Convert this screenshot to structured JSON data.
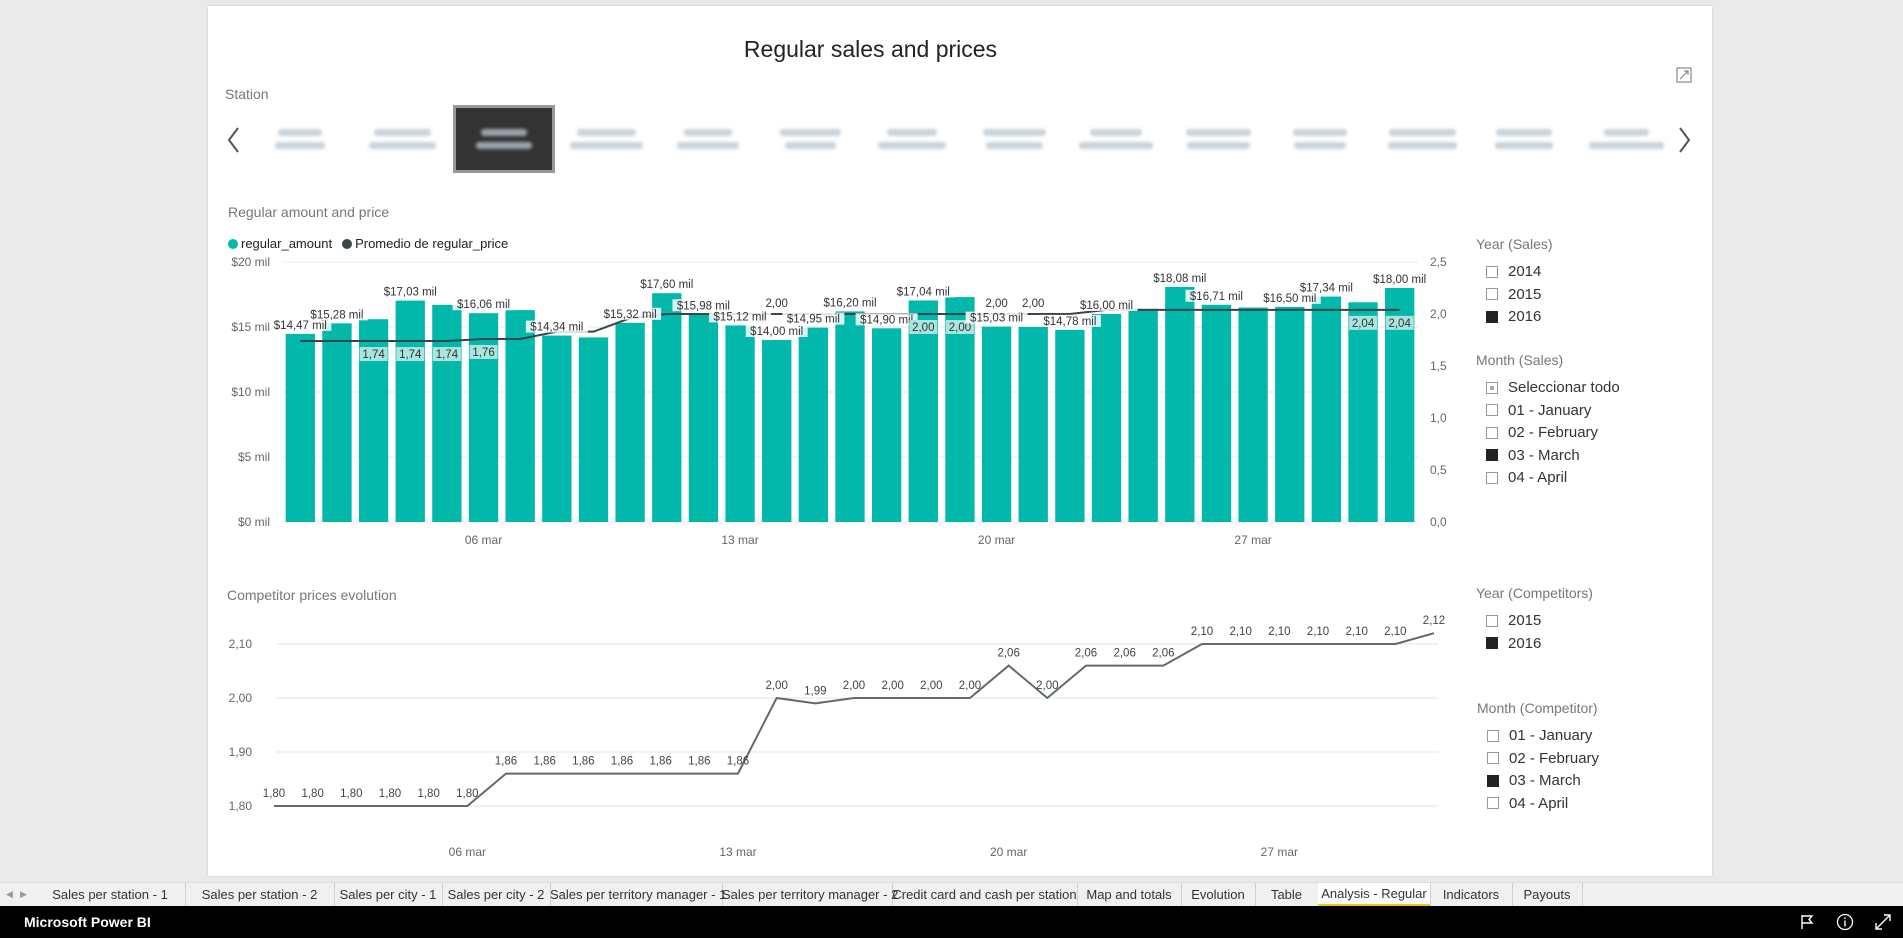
{
  "report": {
    "title": "Regular sales and prices",
    "station_label": "Station",
    "stations_count": 14,
    "selected_station_index": 2
  },
  "bar_chart": {
    "title": "Regular amount and price",
    "legend": [
      {
        "name": "regular_amount",
        "color": "#01b8aa"
      },
      {
        "name": "Promedio de regular_price",
        "color": "#374649"
      }
    ]
  },
  "line_chart": {
    "title": "Competitor prices evolution"
  },
  "filters": {
    "year_sales": {
      "title": "Year (Sales)",
      "items": [
        {
          "label": "2014",
          "state": "off"
        },
        {
          "label": "2015",
          "state": "off"
        },
        {
          "label": "2016",
          "state": "on"
        }
      ]
    },
    "month_sales": {
      "title": "Month (Sales)",
      "items": [
        {
          "label": "Seleccionar todo",
          "state": "partial"
        },
        {
          "label": "01 - January",
          "state": "off"
        },
        {
          "label": "02 - February",
          "state": "off"
        },
        {
          "label": "03 - March",
          "state": "on"
        },
        {
          "label": "04 - April",
          "state": "off"
        }
      ]
    },
    "year_comp": {
      "title": "Year (Competitors)",
      "items": [
        {
          "label": "2015",
          "state": "off"
        },
        {
          "label": "2016",
          "state": "on"
        }
      ]
    },
    "month_comp": {
      "title": "Month (Competitor)",
      "items": [
        {
          "label": "01 - January",
          "state": "off"
        },
        {
          "label": "02 - February",
          "state": "off"
        },
        {
          "label": "03 - March",
          "state": "on"
        },
        {
          "label": "04 - April",
          "state": "off"
        }
      ]
    }
  },
  "tabs": [
    "Sales per station - 1",
    "Sales per station - 2",
    "Sales per city - 1",
    "Sales per city - 2",
    "Sales per territory manager - 1",
    "Sales per territory manager - 2",
    "Credit card and cash per station",
    "Map and totals",
    "Evolution",
    "Table",
    "Analysis - Regular",
    "Indicators",
    "Payouts"
  ],
  "active_tab": "Analysis - Regular",
  "footer": {
    "brand": "Microsoft Power BI"
  },
  "chart_data": [
    {
      "type": "bar",
      "title": "Regular amount and price",
      "xlabel": "",
      "ylabel": "",
      "series": [
        {
          "name": "regular_amount",
          "axis": "left",
          "values": [
            14.47,
            15.28,
            15.6,
            17.03,
            16.7,
            16.06,
            16.3,
            14.34,
            14.2,
            15.32,
            17.6,
            15.98,
            15.12,
            14.0,
            14.95,
            16.2,
            14.9,
            17.04,
            17.3,
            15.03,
            15.0,
            14.78,
            16.0,
            16.4,
            18.08,
            16.71,
            16.5,
            16.55,
            17.34,
            16.9,
            18.0
          ]
        },
        {
          "name": "Promedio de regular_price",
          "axis": "right",
          "values": [
            1.74,
            1.74,
            1.74,
            1.74,
            1.74,
            1.76,
            1.76,
            1.83,
            1.83,
            1.96,
            2.0,
            2.0,
            2.0,
            2.0,
            2.0,
            2.0,
            2.0,
            2.0,
            2.0,
            2.0,
            2.0,
            2.0,
            2.04,
            2.04,
            2.04,
            2.04,
            2.04,
            2.04,
            2.04,
            2.04,
            2.04
          ]
        }
      ],
      "data_labels": [
        {
          "i": 0,
          "text": "$14,47 mil",
          "ty": "bar"
        },
        {
          "i": 1,
          "text": "$15,28 mil",
          "ty": "bar"
        },
        {
          "i": 2,
          "text": "1,74",
          "ty": "box"
        },
        {
          "i": 3,
          "text": "$17,03 mil",
          "ty": "bar"
        },
        {
          "i": 3,
          "text": "1,74",
          "ty": "box"
        },
        {
          "i": 4,
          "text": "1,74",
          "ty": "box"
        },
        {
          "i": 5,
          "text": "$16,06 mil",
          "ty": "bar"
        },
        {
          "i": 5,
          "text": "1,76",
          "ty": "box"
        },
        {
          "i": 7,
          "text": "$14,34 mil",
          "ty": "bar"
        },
        {
          "i": 9,
          "text": "$15,32 mil",
          "ty": "bar"
        },
        {
          "i": 10,
          "text": "$17,60 mil",
          "ty": "bar"
        },
        {
          "i": 11,
          "text": "$15,98 mil",
          "ty": "bar"
        },
        {
          "i": 12,
          "text": "$15,12 mil",
          "ty": "bar"
        },
        {
          "i": 13,
          "text": "2,00",
          "ty": "plain"
        },
        {
          "i": 13,
          "text": "$14,00 mil",
          "ty": "bar"
        },
        {
          "i": 14,
          "text": "$14,95 mil",
          "ty": "bar"
        },
        {
          "i": 15,
          "text": "$16,20 mil",
          "ty": "bar"
        },
        {
          "i": 16,
          "text": "$14,90 mil",
          "ty": "bar"
        },
        {
          "i": 17,
          "text": "$17,04 mil",
          "ty": "bar"
        },
        {
          "i": 17,
          "text": "2,00",
          "ty": "box"
        },
        {
          "i": 18,
          "text": "2,00",
          "ty": "box"
        },
        {
          "i": 19,
          "text": "2,00",
          "ty": "plain"
        },
        {
          "i": 19,
          "text": "$15,03 mil",
          "ty": "bar"
        },
        {
          "i": 20,
          "text": "2,00",
          "ty": "plain"
        },
        {
          "i": 21,
          "text": "$14,78 mil",
          "ty": "bar"
        },
        {
          "i": 22,
          "text": "$16,00 mil",
          "ty": "bar"
        },
        {
          "i": 24,
          "text": "$18,08 mil",
          "ty": "bar"
        },
        {
          "i": 25,
          "text": "$16,71 mil",
          "ty": "bar"
        },
        {
          "i": 27,
          "text": "$16,50 mil",
          "ty": "bar"
        },
        {
          "i": 28,
          "text": "$17,34 mil",
          "ty": "bar"
        },
        {
          "i": 29,
          "text": "2,04",
          "ty": "box"
        },
        {
          "i": 30,
          "text": "$18,00 mil",
          "ty": "bar"
        },
        {
          "i": 30,
          "text": "2,04",
          "ty": "box"
        }
      ],
      "left_ticks": [
        "$0 mil",
        "$5 mil",
        "$10 mil",
        "$15 mil",
        "$20 mil"
      ],
      "left_ylim": [
        0,
        20
      ],
      "right_ticks": [
        "0,0",
        "0,5",
        "1,0",
        "1,5",
        "2,0",
        "2,5"
      ],
      "right_ylim": [
        0,
        2.5
      ],
      "x_ticks": [
        {
          "i": 5,
          "text": "06 mar"
        },
        {
          "i": 12,
          "text": "13 mar"
        },
        {
          "i": 19,
          "text": "20 mar"
        },
        {
          "i": 26,
          "text": "27 mar"
        }
      ]
    },
    {
      "type": "line",
      "title": "Competitor prices evolution",
      "series": [
        {
          "name": "",
          "values": [
            1.8,
            1.8,
            1.8,
            1.8,
            1.8,
            1.8,
            1.86,
            1.86,
            1.86,
            1.86,
            1.86,
            1.86,
            1.86,
            2.0,
            1.99,
            2.0,
            2.0,
            2.0,
            2.0,
            2.06,
            2.0,
            2.06,
            2.06,
            2.06,
            2.1,
            2.1,
            2.1,
            2.1,
            2.1,
            2.1,
            2.12
          ]
        }
      ],
      "labels": [
        "1,80",
        "1,80",
        "1,80",
        "1,80",
        "1,80",
        "1,80",
        "1,86",
        "1,86",
        "1,86",
        "1,86",
        "1,86",
        "1,86",
        "1,86",
        "2,00",
        "1,99",
        "2,00",
        "2,00",
        "2,00",
        "2,00",
        "2,06",
        "2,00",
        "2,06",
        "2,06",
        "2,06",
        "2,10",
        "2,10",
        "2,10",
        "2,10",
        "2,10",
        "2,10",
        "2,12"
      ],
      "y_ticks": [
        "1,80",
        "1,90",
        "2,00",
        "2,10"
      ],
      "ylim": [
        1.8,
        2.1
      ],
      "x_ticks": [
        {
          "i": 5,
          "text": "06 mar"
        },
        {
          "i": 12,
          "text": "13 mar"
        },
        {
          "i": 19,
          "text": "20 mar"
        },
        {
          "i": 26,
          "text": "27 mar"
        }
      ]
    }
  ]
}
